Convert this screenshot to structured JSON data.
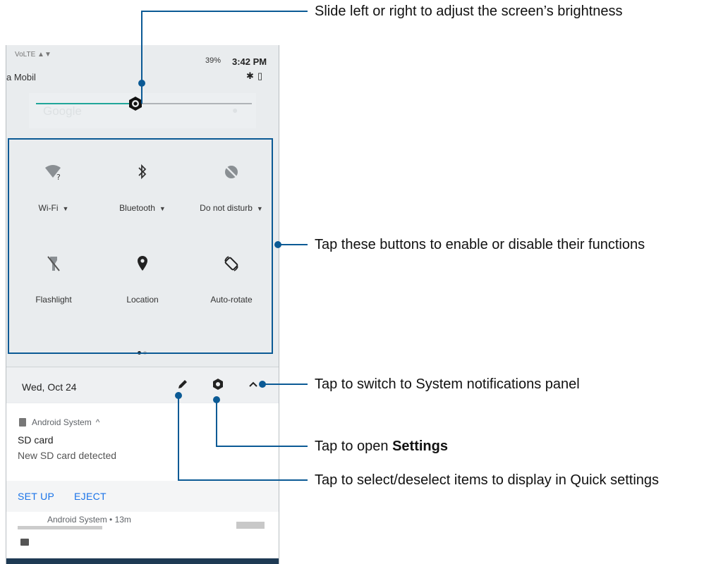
{
  "status_bar": {
    "left_icons": "VoLTE ▲▼",
    "carrier": "a Mobil",
    "battery": "39%",
    "time": "3:42 PM"
  },
  "search_ghost": {
    "text": "Google"
  },
  "brightness": {
    "level": 0.46
  },
  "tiles": [
    {
      "label": "Wi-Fi",
      "icon": "wifi-question-icon",
      "has_menu": true
    },
    {
      "label": "Bluetooth",
      "icon": "bluetooth-icon",
      "has_menu": true
    },
    {
      "label": "Do not disturb",
      "icon": "do-not-disturb-icon",
      "has_menu": true
    },
    {
      "label": "Flashlight",
      "icon": "flashlight-off-icon",
      "has_menu": false
    },
    {
      "label": "Location",
      "icon": "location-pin-icon",
      "has_menu": false
    },
    {
      "label": "Auto-rotate",
      "icon": "auto-rotate-icon",
      "has_menu": false
    }
  ],
  "page_indicator": {
    "pages": 2,
    "current": 1
  },
  "date_row": {
    "date": "Wed, Oct 24"
  },
  "notification": {
    "app": "Android System",
    "title": "SD card",
    "text": "New SD card detected",
    "actions": [
      "SET UP",
      "EJECT"
    ]
  },
  "notification2": {
    "app": "Android System • 13m"
  },
  "annotations": {
    "brightness": "Slide left or right to adjust the screen’s brightness",
    "tiles": "Tap these buttons to enable or disable their functions",
    "switch_panel": "Tap to switch to System notifications panel",
    "settings_prefix": "Tap to open ",
    "settings_bold": "Settings",
    "edit": "Tap to select/deselect items to display in Quick settings"
  },
  "colors": {
    "accent": "#21a69a",
    "callout": "#0b5a95",
    "action_text": "#1a73e8"
  }
}
